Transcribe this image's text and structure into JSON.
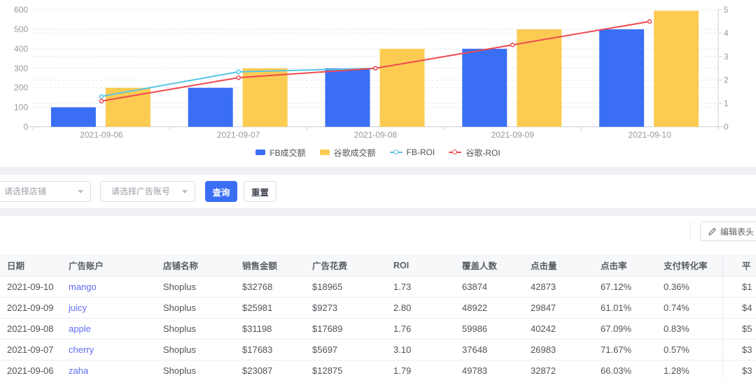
{
  "colors": {
    "accent_blue": "#3A6FF5",
    "bar_blue": "#3A6FF5",
    "bar_yellow": "#FCCC52",
    "line_cyan": "#56C5E6",
    "line_red": "#F0494F",
    "link": "#5E6CF2"
  },
  "chart_data": {
    "type": "bar",
    "subtype": "bar+line dual axis combo",
    "categories": [
      "2021-09-06",
      "2021-09-07",
      "2021-09-08",
      "2021-09-09",
      "2021-09-10"
    ],
    "series": [
      {
        "name": "FB成交额",
        "kind": "bar",
        "axis": "left",
        "color": "#3A6FF5",
        "values": [
          100,
          200,
          300,
          400,
          500
        ]
      },
      {
        "name": "谷歌成交额",
        "kind": "bar",
        "axis": "left",
        "color": "#FCCC52",
        "values": [
          200,
          300,
          400,
          500,
          595
        ]
      },
      {
        "name": "FB-ROI",
        "kind": "line",
        "axis": "right",
        "color": "#56C5E6",
        "values": [
          1.3,
          2.35,
          2.5,
          null,
          null
        ]
      },
      {
        "name": "谷歌-ROI",
        "kind": "line",
        "axis": "right",
        "color": "#F0494F",
        "values": [
          1.1,
          2.1,
          2.5,
          3.5,
          4.5
        ]
      }
    ],
    "left_axis": {
      "min": 0,
      "max": 600,
      "step": 100
    },
    "right_axis": {
      "min": 0,
      "max": 5,
      "step": 1
    },
    "grid": "dashed horizontal gridlines",
    "legend_position": "bottom center"
  },
  "filters": {
    "shop_placeholder": "请选择店铺",
    "account_placeholder": "请选择广告账号",
    "query_label": "查询",
    "reset_label": "重置"
  },
  "table": {
    "edit_header_label": "编辑表头",
    "columns": [
      "日期",
      "广告账户",
      "店铺名称",
      "销售金额",
      "广告花费",
      "ROI",
      "覆盖人数",
      "点击量",
      "点击率",
      "支付转化率",
      "平"
    ],
    "rows": [
      [
        "2021-09-10",
        "mango",
        "Shoplus",
        "$32768",
        "$18965",
        "1.73",
        "63874",
        "42873",
        "67.12%",
        "0.36%",
        "$1"
      ],
      [
        "2021-09-09",
        "juicy",
        "Shoplus",
        "$25981",
        "$9273",
        "2.80",
        "48922",
        "29847",
        "61.01%",
        "0.74%",
        "$4"
      ],
      [
        "2021-09-08",
        "apple",
        "Shoplus",
        "$31198",
        "$17689",
        "1.76",
        "59986",
        "40242",
        "67.09%",
        "0.83%",
        "$5"
      ],
      [
        "2021-09-07",
        "cherry",
        "Shoplus",
        "$17683",
        "$5697",
        "3.10",
        "37648",
        "26983",
        "71.67%",
        "0.57%",
        "$3"
      ],
      [
        "2021-09-06",
        "zaha",
        "Shoplus",
        "$23087",
        "$12875",
        "1.79",
        "49783",
        "32872",
        "66.03%",
        "1.28%",
        "$3"
      ]
    ],
    "link_column_index": 1
  }
}
